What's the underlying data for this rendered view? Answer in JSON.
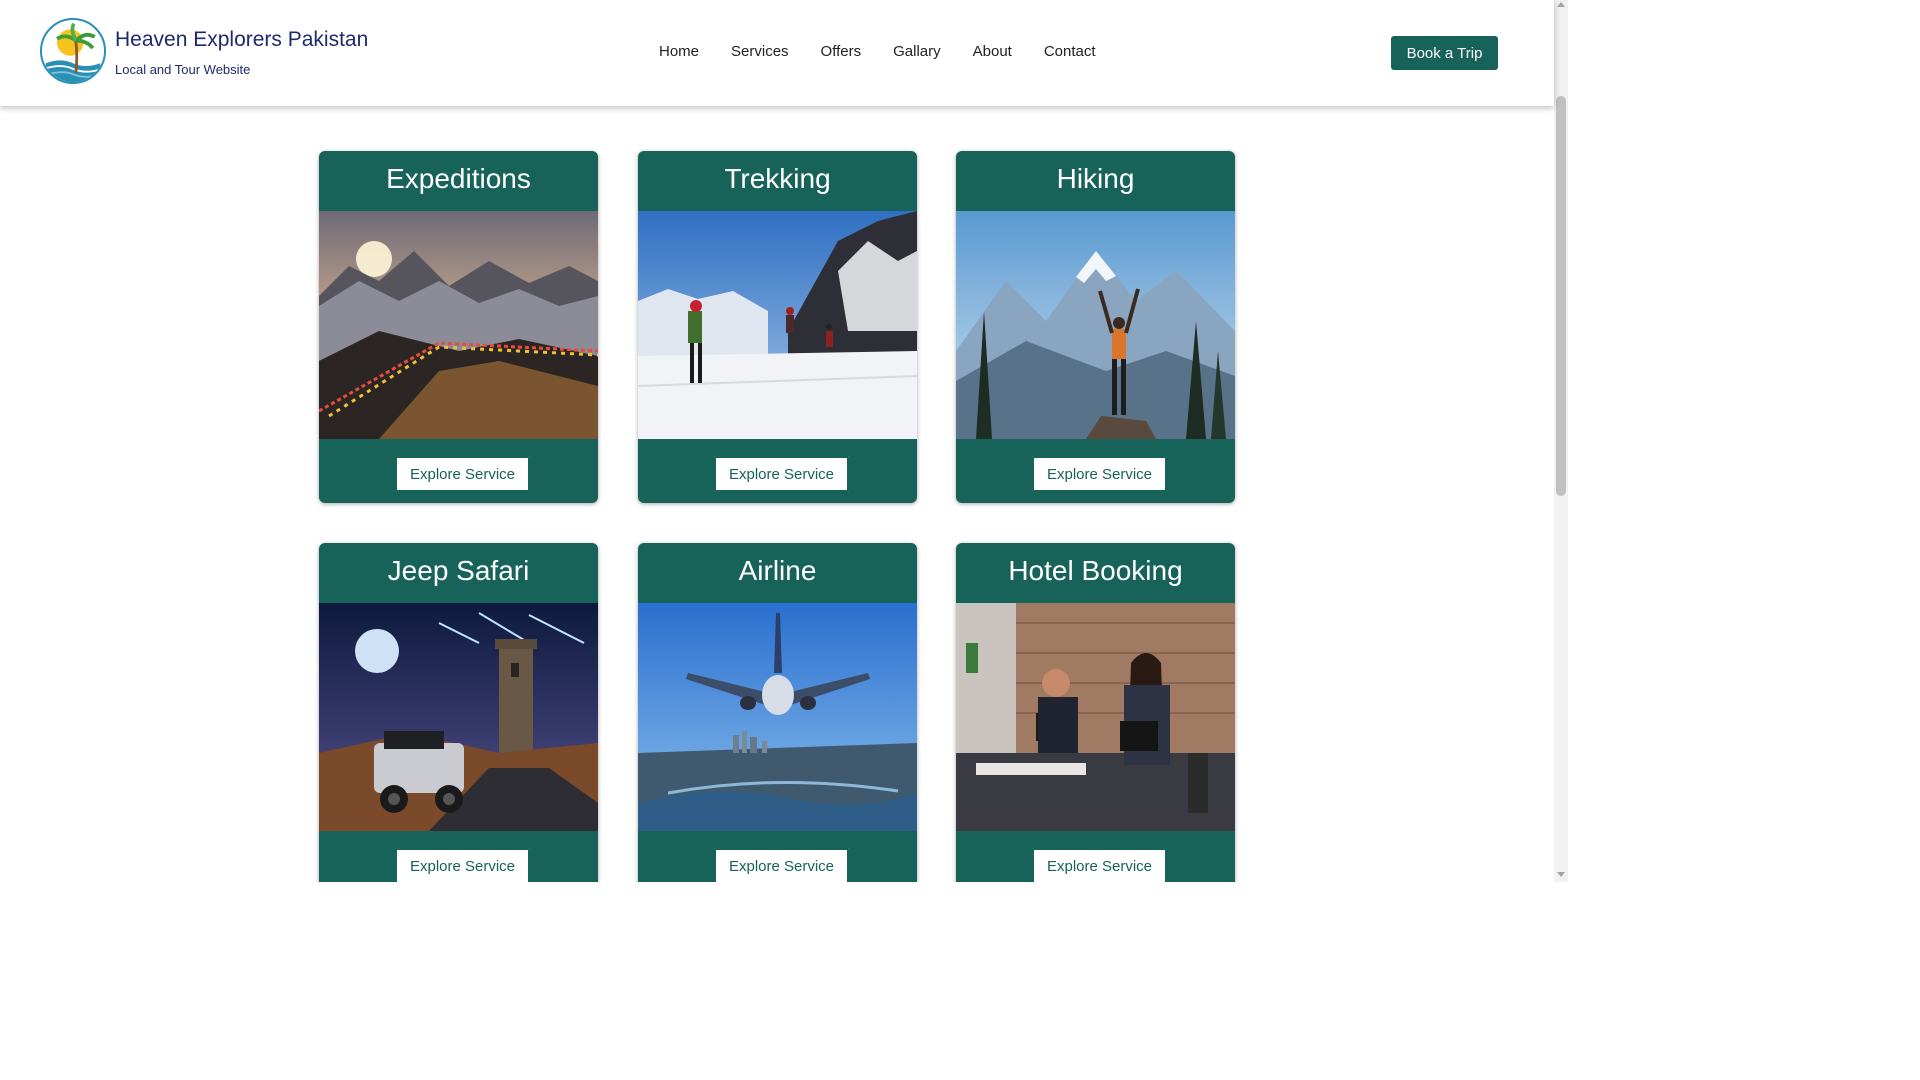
{
  "brand": {
    "title": "Heaven Explorers Pakistan",
    "subtitle": "Local and Tour Website"
  },
  "nav": {
    "items": [
      "Home",
      "Services",
      "Offers",
      "Gallary",
      "About",
      "Contact"
    ]
  },
  "header": {
    "book_label": "Book a Trip"
  },
  "services": [
    {
      "title": "Expeditions",
      "button": "Explore Service",
      "image": "mountain-sunrise-prayer-flags"
    },
    {
      "title": "Trekking",
      "button": "Explore Service",
      "image": "snow-trekkers"
    },
    {
      "title": "Hiking",
      "button": "Explore Service",
      "image": "hiker-on-peak"
    },
    {
      "title": "Jeep Safari",
      "button": "Explore Service",
      "image": "jeep-under-night-sky"
    },
    {
      "title": "Airline",
      "button": "Explore Service",
      "image": "airplane-over-city"
    },
    {
      "title": "Hotel Booking",
      "button": "Explore Service",
      "image": "hotel-reception"
    }
  ],
  "colors": {
    "primary": "#176259",
    "brand_text": "#1f2a6b",
    "background": "#ffffff"
  }
}
